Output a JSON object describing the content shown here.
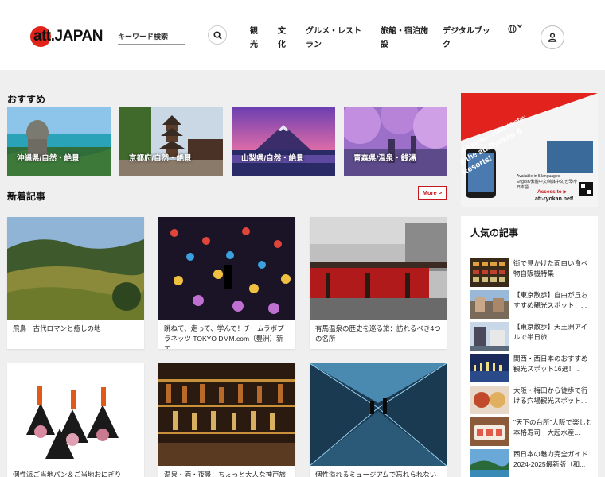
{
  "header": {
    "logo_text": "att.JAPAN",
    "search_placeholder": "キーワード検索",
    "nav": [
      {
        "label": "観光"
      },
      {
        "label": "文化"
      },
      {
        "label": "グルメ・レストラン"
      },
      {
        "label": "旅館・宿泊施設"
      },
      {
        "label": "デジタルブック"
      }
    ],
    "language_icon": "globe-icon"
  },
  "recommended": {
    "title": "おすすめ",
    "items": [
      {
        "label": "沖縄県/自然・絶景"
      },
      {
        "label": "京都府/自然・絶景"
      },
      {
        "label": "山梨県/自然・絶景"
      },
      {
        "label": "青森県/温泉・銭湯"
      }
    ]
  },
  "new_articles": {
    "title": "新着記事",
    "more_label": "More >",
    "items": [
      {
        "title": "飛鳥　古代ロマンと癒しの地"
      },
      {
        "title": "跳ねて、走って、学んで！チームラボプラネッツ TOKYO DMM.com（豊洲）新エ..."
      },
      {
        "title": "有馬温泉の歴史を巡る旅：訪れるべき4つの名所"
      },
      {
        "title": "個性派ご当地パン＆ご当地おにぎり"
      },
      {
        "title": "温泉・酒・夜景！ちょっと大人な神戸旅"
      },
      {
        "title": "個性溢れるミュージアムで忘れられない体"
      }
    ]
  },
  "ad": {
    "line1": "Find a perfect place to stay",
    "line2": "at the att.Ryokan & Resorts!",
    "sub": "Available in 5 languages",
    "langs": "English/繁體中文/简体中文/한국어/日本語",
    "access": "Access to ▶",
    "url": "att-ryokan.net/"
  },
  "popular": {
    "title": "人気の記事",
    "items": [
      {
        "title": "街で見かけた面白い食べ物自販機特集"
      },
      {
        "title": "【東京散歩】自由が丘おすすめ観光スポット！..."
      },
      {
        "title": "【東京散歩】天王洲アイルで半日旅"
      },
      {
        "title": "関西・西日本のおすすめ観光スポット16選！..."
      },
      {
        "title": "大阪・梅田から徒歩で行ける穴場観光スポット..."
      },
      {
        "title": "\"天下の台所\"大阪で楽しむ本格寿司　大起水産..."
      },
      {
        "title": "西日本の魅力完全ガイド2024-2025最新版（和..."
      }
    ]
  }
}
